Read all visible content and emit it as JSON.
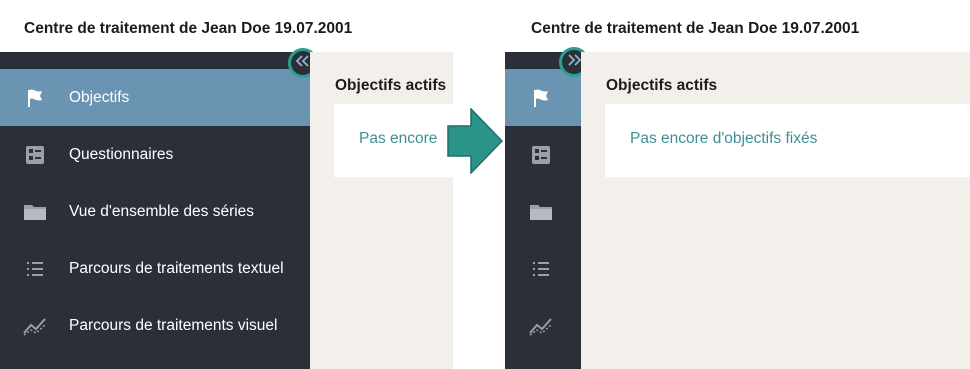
{
  "colors": {
    "sidebar_bg": "#2b3038",
    "active_item_bg": "#6b93b2",
    "content_bg": "#f3f0ec",
    "accent_teal": "#2a9f93",
    "empty_text": "#3f8f96"
  },
  "expanded": {
    "page_title": "Centre de traitement de Jean Doe 19.07.2001",
    "toggle_icon": "double-chevron-left-icon",
    "nav_items": [
      {
        "label": "Objectifs",
        "icon": "flag-icon",
        "active": true
      },
      {
        "label": "Questionnaires",
        "icon": "questionnaire-icon",
        "active": false
      },
      {
        "label": "Vue d'ensemble des séries",
        "icon": "folder-icon",
        "active": false
      },
      {
        "label": "Parcours de traitements textuel",
        "icon": "list-icon",
        "active": false
      },
      {
        "label": "Parcours de traitements visuel",
        "icon": "chart-line-icon",
        "active": false
      }
    ],
    "section_title": "Objectifs actifs",
    "empty_message": "Pas encore"
  },
  "collapsed": {
    "page_title": "Centre de traitement de Jean Doe 19.07.2001",
    "toggle_icon": "double-chevron-right-icon",
    "nav_icons": [
      "flag-icon",
      "questionnaire-icon",
      "folder-icon",
      "list-icon",
      "chart-line-icon"
    ],
    "section_title": "Objectifs actifs",
    "empty_message": "Pas encore d'objectifs fixés"
  },
  "transition_arrow": "arrow-right-icon"
}
